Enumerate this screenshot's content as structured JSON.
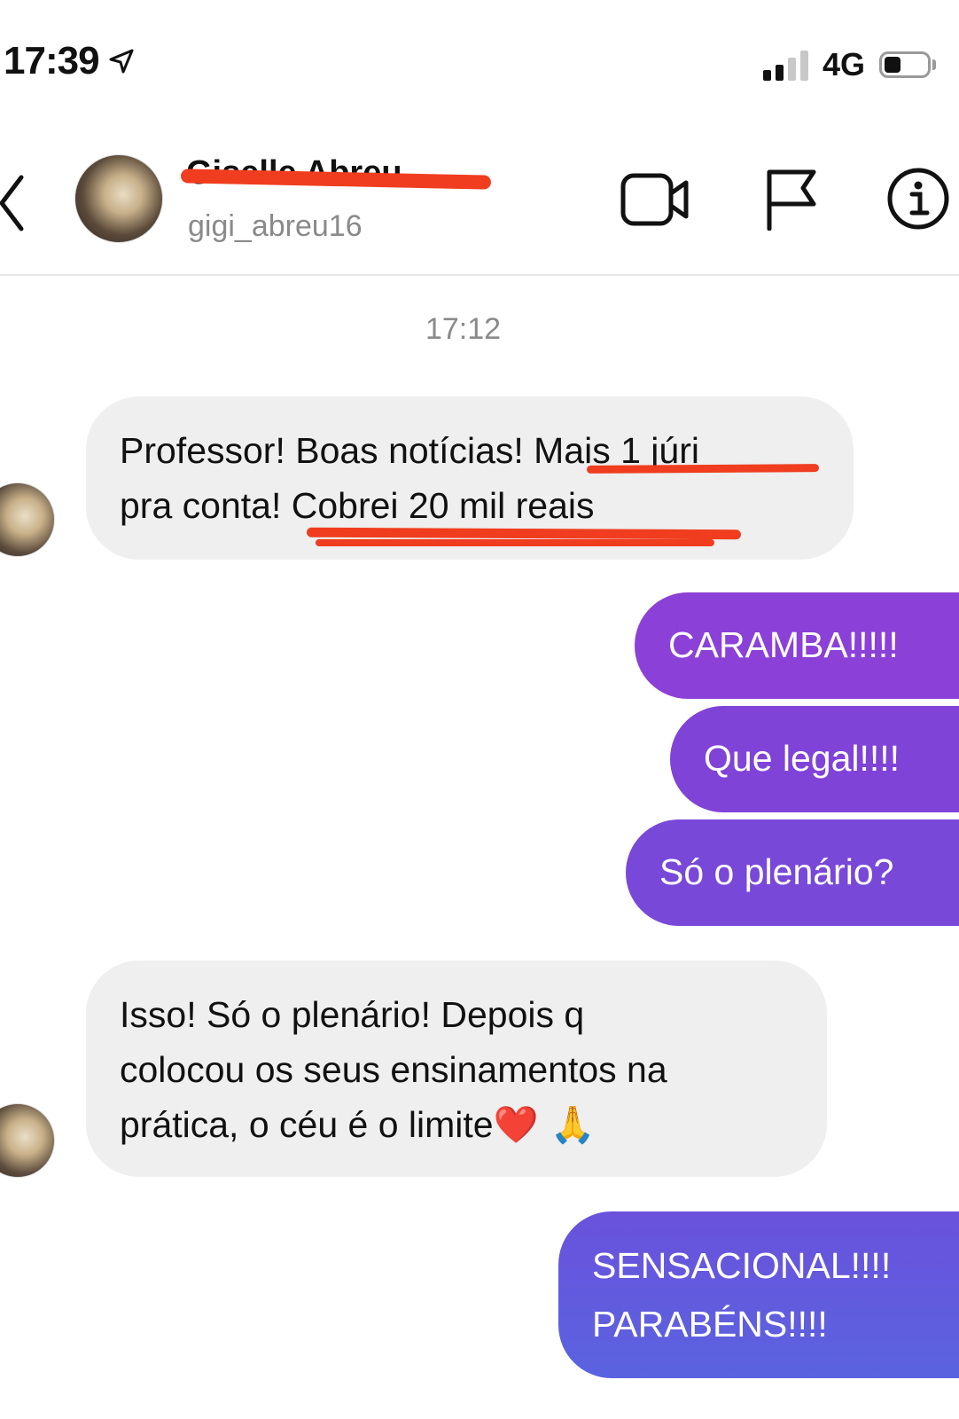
{
  "status_bar": {
    "time": "17:39",
    "network": "4G",
    "battery_level": 0.4
  },
  "header": {
    "contact_name": "Giselle Abreu",
    "username": "gigi_abreu16"
  },
  "chat": {
    "timestamp": "17:12",
    "messages": [
      {
        "sender": "contact",
        "lines": [
          "Professor! Boas notícias! Mais 1 júri",
          "pra conta! Cobrei 20 mil reais"
        ]
      },
      {
        "sender": "me",
        "text": "CARAMBA!!!!!"
      },
      {
        "sender": "me",
        "text": "Que legal!!!!"
      },
      {
        "sender": "me",
        "text": "Só o plenário?"
      },
      {
        "sender": "contact",
        "lines": [
          "Isso! Só o plenário! Depois q",
          "colocou os seus ensinamentos na",
          "prática, o céu é o limite"
        ],
        "emojis": "❤️ 🙏"
      },
      {
        "sender": "me",
        "lines": [
          "SENSACIONAL!!!!",
          "PARABÉNS!!!!"
        ]
      }
    ]
  },
  "colors": {
    "incoming_bubble": "#efefef",
    "outgoing_top": "#8e3fd6",
    "outgoing_bottom": "#5c63e0",
    "annotation_red": "#f03d1f",
    "secondary_text": "#8a8a8a"
  },
  "icons": {
    "location": "location-arrow-icon",
    "back": "chevron-left-icon",
    "video": "video-camera-icon",
    "flag": "flag-icon",
    "info": "info-icon"
  }
}
